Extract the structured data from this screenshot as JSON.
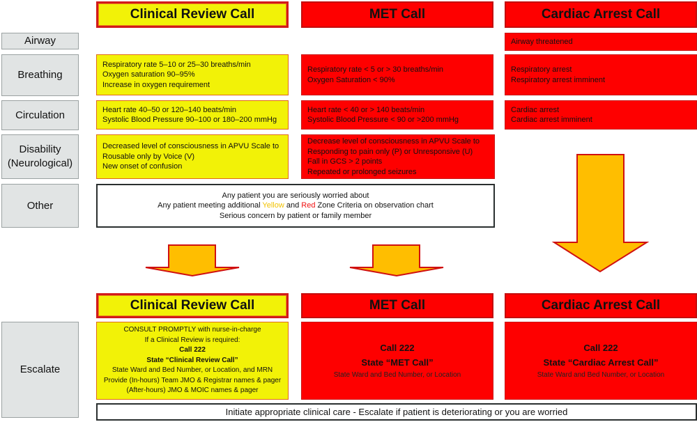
{
  "headers_top": {
    "clinical_review": "Clinical Review Call",
    "met": "MET Call",
    "cardiac_arrest": "Cardiac Arrest Call"
  },
  "rows": {
    "airway": {
      "label": "Airway",
      "cardiac_arrest": [
        "Airway threatened"
      ]
    },
    "breathing": {
      "label": "Breathing",
      "clinical_review": [
        "Respiratory rate 5–10 or 25–30 breaths/min",
        "Oxygen saturation 90–95%",
        "Increase in oxygen requirement"
      ],
      "met": [
        "Respiratory rate < 5 or > 30 breaths/min",
        "Oxygen Saturation < 90%"
      ],
      "cardiac_arrest": [
        "Respiratory arrest",
        "Respiratory arrest imminent"
      ]
    },
    "circulation": {
      "label": "Circulation",
      "clinical_review": [
        "Heart rate 40–50 or 120–140 beats/min",
        "Systolic Blood Pressure 90–100 or 180–200 mmHg"
      ],
      "met": [
        "Heart rate < 40 or > 140 beats/min",
        "Systolic Blood Pressure < 90 or >200 mmHg"
      ],
      "cardiac_arrest": [
        "Cardiac arrest",
        "Cardiac arrest imminent"
      ]
    },
    "disability": {
      "label_line1": "Disability",
      "label_line2": "(Neurological)",
      "clinical_review": [
        "Decreased level of consciousness in APVU Scale to",
        "Rousable only by Voice (V)",
        "New onset of confusion"
      ],
      "met": [
        "Decrease level of consciousness in APVU Scale to",
        "Responding to pain only (P) or Unresponsive (U)",
        "Fall in GCS > 2 points",
        "Repeated or prolonged seizures"
      ]
    },
    "other": {
      "label": "Other",
      "line1": "Any patient you are seriously worried about",
      "line2_pre": "Any patient meeting additional ",
      "line2_yellow": "Yellow",
      "line2_mid": " and ",
      "line2_red": "Red",
      "line2_post": " Zone Criteria on observation chart",
      "line3": "Serious concern by patient or family member"
    }
  },
  "headers_bottom": {
    "clinical_review": "Clinical Review Call",
    "met": "MET Call",
    "cardiac_arrest": "Cardiac Arrest Call"
  },
  "escalate": {
    "label": "Escalate",
    "clinical_review": {
      "line1": "CONSULT PROMPTLY with nurse-in-charge",
      "line2": "If a Clinical Review is required:",
      "call": "Call 222",
      "state": "State “Clinical Review Call”",
      "line5": "State Ward and Bed Number, or Location, and MRN",
      "line6": "Provide (In-hours) Team JMO & Registrar names & pager",
      "line7": "(After-hours) JMO & MOIC names & pager"
    },
    "met": {
      "call": "Call 222",
      "state": "State “MET Call”",
      "location": "State Ward and Bed Number, or Location"
    },
    "cardiac_arrest": {
      "call": "Call 222",
      "state": "State “Cardiac Arrest Call”",
      "location": "State Ward and Bed Number, or Location"
    }
  },
  "footer": "Initiate appropriate clinical care - Escalate if patient is deteriorating or you are worried",
  "colors": {
    "yellow_zone": "#f2f207",
    "red_zone": "#fe0000",
    "arrow_fill": "#ffbe00",
    "arrow_stroke": "#d01010",
    "label_bg": "#e1e4e4"
  }
}
